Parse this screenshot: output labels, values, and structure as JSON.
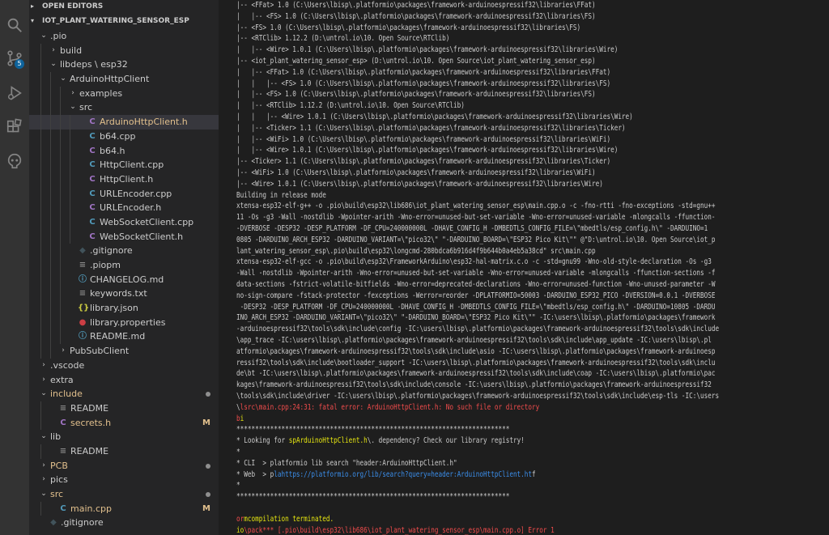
{
  "sidebar": {
    "open_editors": "OPEN EDITORS",
    "project": "IOT_PLANT_WATERING_SENSOR_ESP",
    "scm_badge": "5"
  },
  "tree": [
    {
      "label": ".pio",
      "type": "folder",
      "open": true,
      "depth": 0
    },
    {
      "label": "build",
      "type": "folder",
      "open": false,
      "depth": 1
    },
    {
      "label": "libdeps \\ esp32",
      "type": "folder",
      "open": true,
      "depth": 1
    },
    {
      "label": "ArduinoHttpClient",
      "type": "folder",
      "open": true,
      "depth": 2
    },
    {
      "label": "examples",
      "type": "folder",
      "open": false,
      "depth": 3
    },
    {
      "label": "src",
      "type": "folder",
      "open": true,
      "depth": 3
    },
    {
      "label": "ArduinoHttpClient.h",
      "type": "c",
      "depth": 4,
      "selected": true,
      "color": "#e2c08d"
    },
    {
      "label": "b64.cpp",
      "type": "cpp",
      "depth": 4
    },
    {
      "label": "b64.h",
      "type": "c",
      "depth": 4
    },
    {
      "label": "HttpClient.cpp",
      "type": "cpp",
      "depth": 4
    },
    {
      "label": "HttpClient.h",
      "type": "c",
      "depth": 4
    },
    {
      "label": "URLEncoder.cpp",
      "type": "cpp",
      "depth": 4
    },
    {
      "label": "URLEncoder.h",
      "type": "c",
      "depth": 4
    },
    {
      "label": "WebSocketClient.cpp",
      "type": "cpp",
      "depth": 4
    },
    {
      "label": "WebSocketClient.h",
      "type": "c",
      "depth": 4
    },
    {
      "label": ".gitignore",
      "type": "git",
      "depth": 3
    },
    {
      "label": ".piopm",
      "type": "file",
      "depth": 3
    },
    {
      "label": "CHANGELOG.md",
      "type": "md",
      "depth": 3
    },
    {
      "label": "keywords.txt",
      "type": "txt",
      "depth": 3
    },
    {
      "label": "library.json",
      "type": "json",
      "depth": 3
    },
    {
      "label": "library.properties",
      "type": "props",
      "depth": 3
    },
    {
      "label": "README.md",
      "type": "md",
      "depth": 3
    },
    {
      "label": "PubSubClient",
      "type": "folder",
      "open": false,
      "depth": 2
    },
    {
      "label": ".vscode",
      "type": "folder",
      "open": false,
      "depth": 0
    },
    {
      "label": "extra",
      "type": "folder",
      "open": false,
      "depth": 0
    },
    {
      "label": "include",
      "type": "folder",
      "open": true,
      "depth": 0,
      "color": "#e2c08d",
      "dot": true
    },
    {
      "label": "README",
      "type": "readme",
      "depth": 1
    },
    {
      "label": "secrets.h",
      "type": "c",
      "depth": 1,
      "color": "#e2c08d",
      "marker": "M"
    },
    {
      "label": "lib",
      "type": "folder",
      "open": true,
      "depth": 0
    },
    {
      "label": "README",
      "type": "readme",
      "depth": 1
    },
    {
      "label": "PCB",
      "type": "folder",
      "open": false,
      "depth": 0,
      "color": "#e2c08d",
      "dot": true
    },
    {
      "label": "pics",
      "type": "folder",
      "open": false,
      "depth": 0
    },
    {
      "label": "src",
      "type": "folder",
      "open": true,
      "depth": 0,
      "color": "#e2c08d",
      "dot": true
    },
    {
      "label": "main.cpp",
      "type": "cpp",
      "depth": 1,
      "color": "#e2c08d",
      "marker": "M"
    },
    {
      "label": ".gitignore",
      "type": "git",
      "depth": 0
    }
  ],
  "colors": {
    "error_red": "#f14c4c",
    "warn_yellow": "#e5e510",
    "link_blue": "#3b8eea",
    "modified": "#e2c08d"
  },
  "terminal": {
    "lines": [
      [
        {
          "t": "|-- <FFat> 1.0 (C:\\Users\\lbisp\\.platformio\\packages\\framework-arduinoespressif32\\libraries\\FFat)"
        }
      ],
      [
        {
          "t": "|   |-- <FS> 1.0 (C:\\Users\\lbisp\\.platformio\\packages\\framework-arduinoespressif32\\libraries\\FS)"
        }
      ],
      [
        {
          "t": "|-- <FS> 1.0 (C:\\Users\\lbisp\\.platformio\\packages\\framework-arduinoespressif32\\libraries\\FS)"
        }
      ],
      [
        {
          "t": "|-- <RTClib> 1.12.2 (D:\\untrol.io\\10. Open Source\\RTClib)"
        }
      ],
      [
        {
          "t": "|   |-- <Wire> 1.0.1 (C:\\Users\\lbisp\\.platformio\\packages\\framework-arduinoespressif32\\libraries\\Wire)"
        }
      ],
      [
        {
          "t": "|-- <iot_plant_watering_sensor_esp> (D:\\untrol.io\\10. Open Source\\iot_plant_watering_sensor_esp)"
        }
      ],
      [
        {
          "t": "|   |-- <FFat> 1.0 (C:\\Users\\lbisp\\.platformio\\packages\\framework-arduinoespressif32\\libraries\\FFat)"
        }
      ],
      [
        {
          "t": "|   |   |-- <FS> 1.0 (C:\\Users\\lbisp\\.platformio\\packages\\framework-arduinoespressif32\\libraries\\FS)"
        }
      ],
      [
        {
          "t": "|   |-- <FS> 1.0 (C:\\Users\\lbisp\\.platformio\\packages\\framework-arduinoespressif32\\libraries\\FS)"
        }
      ],
      [
        {
          "t": "|   |-- <RTClib> 1.12.2 (D:\\untrol.io\\10. Open Source\\RTClib)"
        }
      ],
      [
        {
          "t": "|   |   |-- <Wire> 1.0.1 (C:\\Users\\lbisp\\.platformio\\packages\\framework-arduinoespressif32\\libraries\\Wire)"
        }
      ],
      [
        {
          "t": "|   |-- <Ticker> 1.1 (C:\\Users\\lbisp\\.platformio\\packages\\framework-arduinoespressif32\\libraries\\Ticker)"
        }
      ],
      [
        {
          "t": "|   |-- <WiFi> 1.0 (C:\\Users\\lbisp\\.platformio\\packages\\framework-arduinoespressif32\\libraries\\WiFi)"
        }
      ],
      [
        {
          "t": "|   |-- <Wire> 1.0.1 (C:\\Users\\lbisp\\.platformio\\packages\\framework-arduinoespressif32\\libraries\\Wire)"
        }
      ],
      [
        {
          "t": "|-- <Ticker> 1.1 (C:\\Users\\lbisp\\.platformio\\packages\\framework-arduinoespressif32\\libraries\\Ticker)"
        }
      ],
      [
        {
          "t": "|-- <WiFi> 1.0 (C:\\Users\\lbisp\\.platformio\\packages\\framework-arduinoespressif32\\libraries\\WiFi)"
        }
      ],
      [
        {
          "t": "|-- <Wire> 1.0.1 (C:\\Users\\lbisp\\.platformio\\packages\\framework-arduinoespressif32\\libraries\\Wire)"
        }
      ],
      [
        {
          "t": "Building in release mode"
        }
      ],
      [
        {
          "t": "xtensa-esp32-elf-g++ -o .pio\\build\\esp32\\lib686\\iot_plant_watering_sensor_esp\\main.cpp.o -c -fno-rtti -fno-exceptions -std=gnu++"
        }
      ],
      [
        {
          "t": "11 -Os -g3 -Wall -nostdlib -Wpointer-arith -Wno-error=unused-but-set-variable -Wno-error=unused-variable -mlongcalls -ffunction-"
        }
      ],
      [
        {
          "t": "-DVERBOSE -DESP32 -DESP_PLATFORM -DF_CPU=240000000L -DHAVE_CONFIG_H -DMBEDTLS_CONFIG_FILE=\\\"mbedtls/esp_config.h\\\" -DARDUINO=1"
        }
      ],
      [
        {
          "t": "0805 -DARDUINO_ARCH_ESP32 -DARDUINO_VARIANT=\\\"pico32\\\" \"-DARDUINO_BOARD=\\\"ESP32 Pico Kit\\\"\" @\"D:\\untrol.io\\10. Open Source\\iot_p"
        }
      ],
      [
        {
          "t": "lant_watering_sensor_esp\\.pio\\build\\esp32\\longcmd-280bdca6b916d4f9b644b0a4eb5a38cd\" src\\main.cpp"
        }
      ],
      [
        {
          "t": "xtensa-esp32-elf-gcc -o .pio\\build\\esp32\\FrameworkArduino\\esp32-hal-matrix.c.o -c -std=gnu99 -Wno-old-style-declaration -Os -g3"
        }
      ],
      [
        {
          "t": "-Wall -nostdlib -Wpointer-arith -Wno-error=unused-but-set-variable -Wno-error=unused-variable -mlongcalls -ffunction-sections -f"
        }
      ],
      [
        {
          "t": "data-sections -fstrict-volatile-bitfields -Wno-error=deprecated-declarations -Wno-error=unused-function -Wno-unused-parameter -W"
        }
      ],
      [
        {
          "t": "no-sign-compare -fstack-protector -fexceptions -Werror=reorder -DPLATFORMIO=50003 -DARDUINO_ESP32_PICO -DVERSION=0.0.1 -DVERBOSE"
        }
      ],
      [
        {
          "t": " -DESP32 -DESP_PLATFORM -DF_CPU=240000000L -DHAVE_CONFIG_H -DMBEDTLS_CONFIG_FILE=\\\"mbedtls/esp_config.h\\\" -DARDUINO=10805 -DARDU"
        }
      ],
      [
        {
          "t": "INO_ARCH_ESP32 -DARDUINO_VARIANT=\\\"pico32\\\" \"-DARDUINO_BOARD=\\\"ESP32 Pico Kit\\\"\" -IC:\\users\\lbisp\\.platformio\\packages\\framework"
        }
      ],
      [
        {
          "t": "-arduinoespressif32\\tools\\sdk\\include\\config -IC:\\users\\lbisp\\.platformio\\packages\\framework-arduinoespressif32\\tools\\sdk\\include"
        }
      ],
      [
        {
          "t": "\\app_trace -IC:\\users\\lbisp\\.platformio\\packages\\framework-arduinoespressif32\\tools\\sdk\\include\\app_update -IC:\\users\\lbisp\\.pl"
        }
      ],
      [
        {
          "t": "atformio\\packages\\framework-arduinoespressif32\\tools\\sdk\\include\\asio -IC:\\users\\lbisp\\.platformio\\packages\\framework-arduinoesp"
        }
      ],
      [
        {
          "t": "ressif32\\tools\\sdk\\include\\bootloader_support -IC:\\users\\lbisp\\.platformio\\packages\\framework-arduinoespressif32\\tools\\sdk\\inclu"
        }
      ],
      [
        {
          "t": "de\\bt -IC:\\users\\lbisp\\.platformio\\packages\\framework-arduinoespressif32\\tools\\sdk\\include\\coap -IC:\\users\\lbisp\\.platformio\\pac"
        }
      ],
      [
        {
          "t": "kages\\framework-arduinoespressif32\\tools\\sdk\\include\\console -IC:\\users\\lbisp\\.platformio\\packages\\framework-arduinoespressif32"
        }
      ],
      [
        {
          "t": "\\tools\\sdk\\include\\driver -IC:\\users\\lbisp\\.platformio\\packages\\framework-arduinoespressif32\\tools\\sdk\\include\\esp-tls -IC:\\users"
        }
      ],
      [
        {
          "t": "\\"
        },
        {
          "t": "lsrc\\main.cpp:24:31: fatal error: ArduinoHttpClient.h: No such file or directory",
          "c": "r"
        }
      ],
      [
        {
          "t": "b",
          "c": "r"
        },
        {
          "t": "i",
          "c": "y"
        }
      ],
      [
        {
          "t": "*************************************************************************"
        }
      ],
      [
        {
          "t": "* Looking for "
        },
        {
          "t": "s",
          "c": "y"
        },
        {
          "t": "pArduinoHttpClient.h",
          "c": "y"
        },
        {
          "t": "\\. dependency? Check our library registry!"
        }
      ],
      [
        {
          "t": "*"
        }
      ],
      [
        {
          "t": "* CLI  > platformio lib search \"header:ArduinoHttpClient.h\""
        }
      ],
      [
        {
          "t": "* Web  > p"
        },
        {
          "t": "lahttps://platformio.org/lib/search?query=header:ArduinoHttpClient.ht",
          "c": "lk"
        },
        {
          "t": "f"
        }
      ],
      [
        {
          "t": "*"
        }
      ],
      [
        {
          "t": "*************************************************************************"
        }
      ],
      [
        {
          "t": ""
        }
      ],
      [
        {
          "t": "or",
          "c": "r"
        },
        {
          "t": "mcompilation terminated.",
          "c": "y"
        }
      ],
      [
        {
          "t": "io",
          "c": "y"
        },
        {
          "t": "\\pack*** [.pio\\build\\esp32\\lib686\\iot_plant_watering_sensor_esp\\main.cpp.o] Error 1",
          "c": "r"
        }
      ]
    ]
  }
}
